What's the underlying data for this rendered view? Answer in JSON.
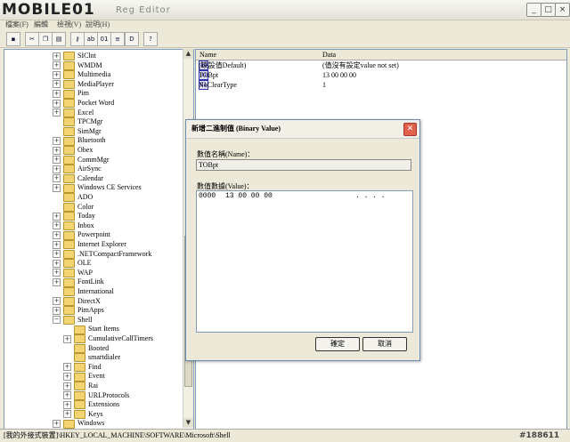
{
  "app": {
    "logo_text": "MOBILE01",
    "title_suffix": "Reg Editor"
  },
  "menu": [
    {
      "label": "檔案(F)"
    },
    {
      "label": "編輯"
    },
    {
      "label": "檢視(V)"
    },
    {
      "label": "說明(H)"
    }
  ],
  "toolbar": {
    "buttons": [
      "save-icon",
      "cut-icon",
      "copy-icon",
      "paste-icon",
      "new-key-icon",
      "new-string-icon",
      "new-binary-icon",
      "new-dword-icon",
      "help-icon"
    ]
  },
  "tree": {
    "items": [
      {
        "label": "SIClnt",
        "expand": "+"
      },
      {
        "label": "WMDM",
        "expand": "+"
      },
      {
        "label": "Multimedia",
        "expand": "+"
      },
      {
        "label": "MediaPlayer",
        "expand": "+"
      },
      {
        "label": "Pim",
        "expand": "+"
      },
      {
        "label": "Pocket Word",
        "expand": "+"
      },
      {
        "label": "Excel",
        "expand": "+"
      },
      {
        "label": "TPCMgr",
        "expand": ""
      },
      {
        "label": "SimMgr",
        "expand": ""
      },
      {
        "label": "Bluetooth",
        "expand": "+"
      },
      {
        "label": "Obex",
        "expand": "+"
      },
      {
        "label": "CommMgr",
        "expand": "+"
      },
      {
        "label": "AirSync",
        "expand": "+"
      },
      {
        "label": "Calendar",
        "expand": "+"
      },
      {
        "label": "Windows CE Services",
        "expand": "+"
      },
      {
        "label": "ADO",
        "expand": ""
      },
      {
        "label": "Color",
        "expand": ""
      },
      {
        "label": "Today",
        "expand": "+"
      },
      {
        "label": "Inbox",
        "expand": "+"
      },
      {
        "label": "Powerpoint",
        "expand": "+"
      },
      {
        "label": "Internet Explorer",
        "expand": "+"
      },
      {
        "label": ".NETCompactFramework",
        "expand": "+"
      },
      {
        "label": "OLE",
        "expand": "+"
      },
      {
        "label": "WAP",
        "expand": "+"
      },
      {
        "label": "FontLink",
        "expand": "+"
      },
      {
        "label": "International",
        "expand": ""
      },
      {
        "label": "DirectX",
        "expand": "+"
      },
      {
        "label": "PimApps",
        "expand": "+"
      },
      {
        "label": "Shell",
        "expand": "−"
      },
      {
        "label": "Start Items",
        "expand": "",
        "child": true
      },
      {
        "label": "CumulativeCallTimers",
        "expand": "+",
        "child": true
      },
      {
        "label": "Booted",
        "expand": "",
        "child": true
      },
      {
        "label": "smartdialer",
        "expand": "",
        "child": true
      },
      {
        "label": "Find",
        "expand": "+",
        "child": true
      },
      {
        "label": "Event",
        "expand": "+",
        "child": true
      },
      {
        "label": "Rai",
        "expand": "+",
        "child": true
      },
      {
        "label": "URLProtocols",
        "expand": "+",
        "child": true
      },
      {
        "label": "Extensions",
        "expand": "+",
        "child": true
      },
      {
        "label": "Keys",
        "expand": "+",
        "child": true
      },
      {
        "label": "Windows",
        "expand": "+"
      }
    ]
  },
  "list": {
    "col_name": "Name",
    "col_data": "Data",
    "rows": [
      {
        "icon": "ab",
        "name": "(缺設值Default)",
        "data": "(值沒有設定value not set)"
      },
      {
        "icon": "01",
        "name": "TOBpt",
        "data": "13 00 00 00"
      },
      {
        "icon": "01",
        "name": "NoClearType",
        "data": "1"
      }
    ]
  },
  "status": {
    "path": "[我的外接式裝置]\\HKEY_LOCAL_MACHINE\\SOFTWARE\\Microsoft\\Shell",
    "watermark": "#188611"
  },
  "dialog": {
    "title": "新增二進制值 (Binary Value)",
    "name_label": "數值名稱(Name)：",
    "name_value": "TOBpt",
    "data_label": "數值數據(Value)：",
    "data_offset": "0000",
    "data_bytes": "13  00  00  00",
    "data_ascii": ". . . .",
    "ok_label": "確定",
    "cancel_label": "取消"
  }
}
